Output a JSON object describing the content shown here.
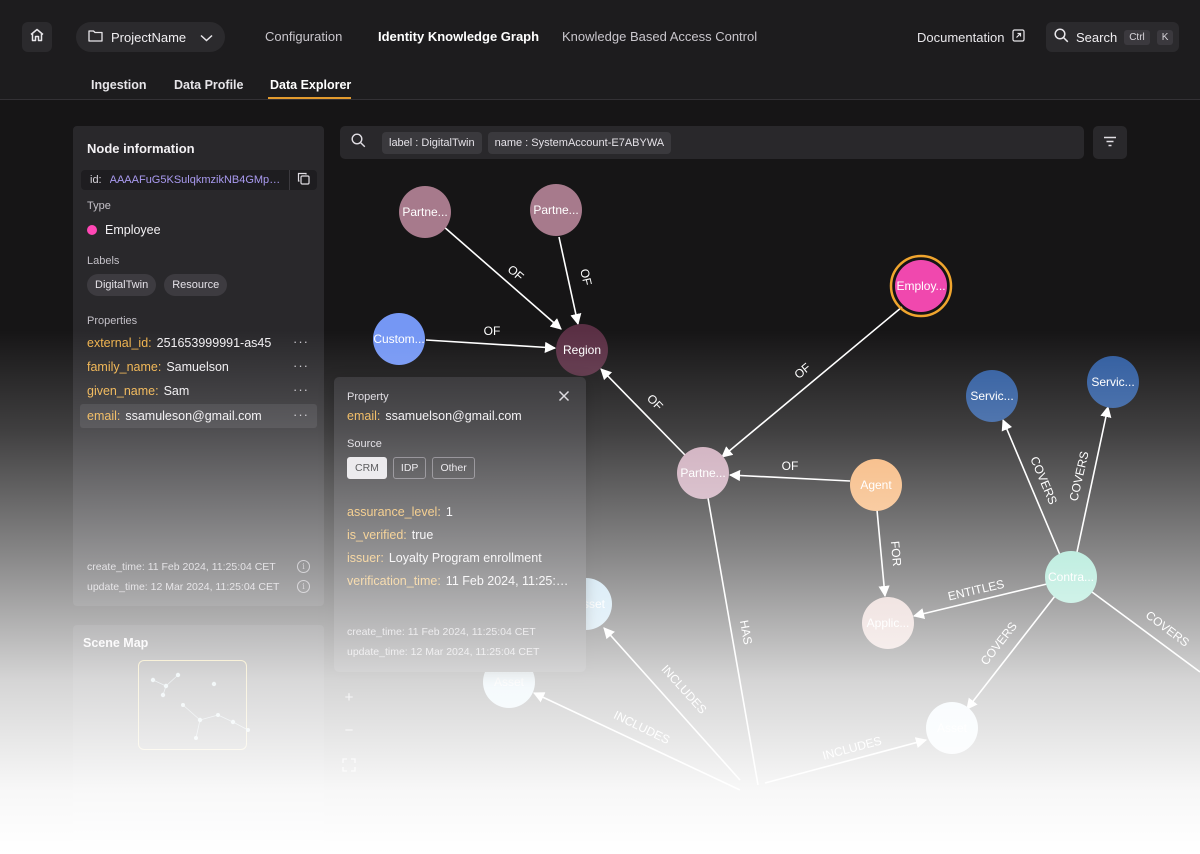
{
  "header": {
    "project_name": "ProjectName",
    "nav": [
      "Configuration",
      "Identity Knowledge Graph",
      "Knowledge Based Access Control"
    ],
    "active_nav": "Identity Knowledge Graph",
    "documentation": "Documentation",
    "search_label": "Search",
    "shortcut_mod": "Ctrl",
    "shortcut_key": "K"
  },
  "subtabs": [
    "Ingestion",
    "Data Profile",
    "Data Explorer"
  ],
  "active_subtab": "Data Explorer",
  "node_panel": {
    "title": "Node information",
    "id_label": "id:",
    "id_value": "AAAAFuG5KSulqkmzikNB4GMp4l...",
    "type_label": "Type",
    "type_value": "Employee",
    "type_color": "#ff47b5",
    "labels_label": "Labels",
    "labels": [
      "DigitalTwin",
      "Resource"
    ],
    "properties_label": "Properties",
    "properties": [
      {
        "key": "external_id:",
        "value": "251653999991-as45"
      },
      {
        "key": "family_name:",
        "value": "Samuelson"
      },
      {
        "key": "given_name:",
        "value": "Sam"
      },
      {
        "key": "email:",
        "value": "ssamuleson@gmail.com"
      }
    ],
    "create_time": "create_time: 11 Feb 2024, 11:25:04 CET",
    "update_time": "update_time: 12 Mar 2024, 11:25:04 CET"
  },
  "scene_map": {
    "title": "Scene Map"
  },
  "graph_search": {
    "tags": [
      "label : DigitalTwin",
      "name : SystemAccount-E7ABYWA"
    ]
  },
  "zoom_controls": [
    "+",
    "−"
  ],
  "property_popup": {
    "title": "Property",
    "email_key": "email:",
    "email_value": "ssamuelson@gmail.com",
    "source_label": "Source",
    "sources": [
      "CRM",
      "IDP",
      "Other"
    ],
    "active_source": "CRM",
    "props": [
      {
        "key": "assurance_level:",
        "value": "1"
      },
      {
        "key": "is_verified:",
        "value": "true"
      },
      {
        "key": "issuer:",
        "value": "Loyalty Program enrollment"
      },
      {
        "key": "verification_time:",
        "value": "11 Feb 2024, 11:25:04..."
      }
    ],
    "create_time": "create_time: 11 Feb 2024, 11:25:04 CET",
    "update_time": "update_time: 12 Mar 2024, 11:25:04 CET"
  },
  "graph": {
    "nodes": [
      {
        "id": "partner1",
        "label": "Partne...",
        "color": "#a77a8c"
      },
      {
        "id": "partner2",
        "label": "Partne...",
        "color": "#a77a8c"
      },
      {
        "id": "customer",
        "label": "Custom...",
        "color": "#7597f4"
      },
      {
        "id": "region",
        "label": "Region",
        "color": "#5a2f44"
      },
      {
        "id": "employee",
        "label": "Employ...",
        "color": "#f048ae"
      },
      {
        "id": "partner3",
        "label": "Partne...",
        "color": "#c7a1b3"
      },
      {
        "id": "agent",
        "label": "Agent",
        "color": "#f5ad6a"
      },
      {
        "id": "application",
        "label": "Applic...",
        "color": "#dcbcb7"
      },
      {
        "id": "service1",
        "label": "Servic...",
        "color": "#2d5a9e"
      },
      {
        "id": "service2",
        "label": "Servic...",
        "color": "#2d5a9e"
      },
      {
        "id": "contract",
        "label": "Contra...",
        "color": "#86dec5"
      },
      {
        "id": "asset1",
        "label": "Asset",
        "color": "#b3d8ee"
      },
      {
        "id": "asset2",
        "label": "Asset",
        "color": "#c7e4f3"
      },
      {
        "id": "asset3",
        "label": "Asset",
        "color": "#d8ecf6"
      }
    ],
    "edges": [
      {
        "label": "OF"
      },
      {
        "label": "OF"
      },
      {
        "label": "OF"
      },
      {
        "label": "OF"
      },
      {
        "label": "OF"
      },
      {
        "label": "OF"
      },
      {
        "label": "FOR"
      },
      {
        "label": "HAS"
      },
      {
        "label": "COVERS"
      },
      {
        "label": "COVERS"
      },
      {
        "label": "ENTITLES"
      },
      {
        "label": "COVERS"
      },
      {
        "label": "COVERS"
      },
      {
        "label": "INCLUDES"
      },
      {
        "label": "INCLUDES"
      },
      {
        "label": "INCLUDES"
      }
    ]
  }
}
